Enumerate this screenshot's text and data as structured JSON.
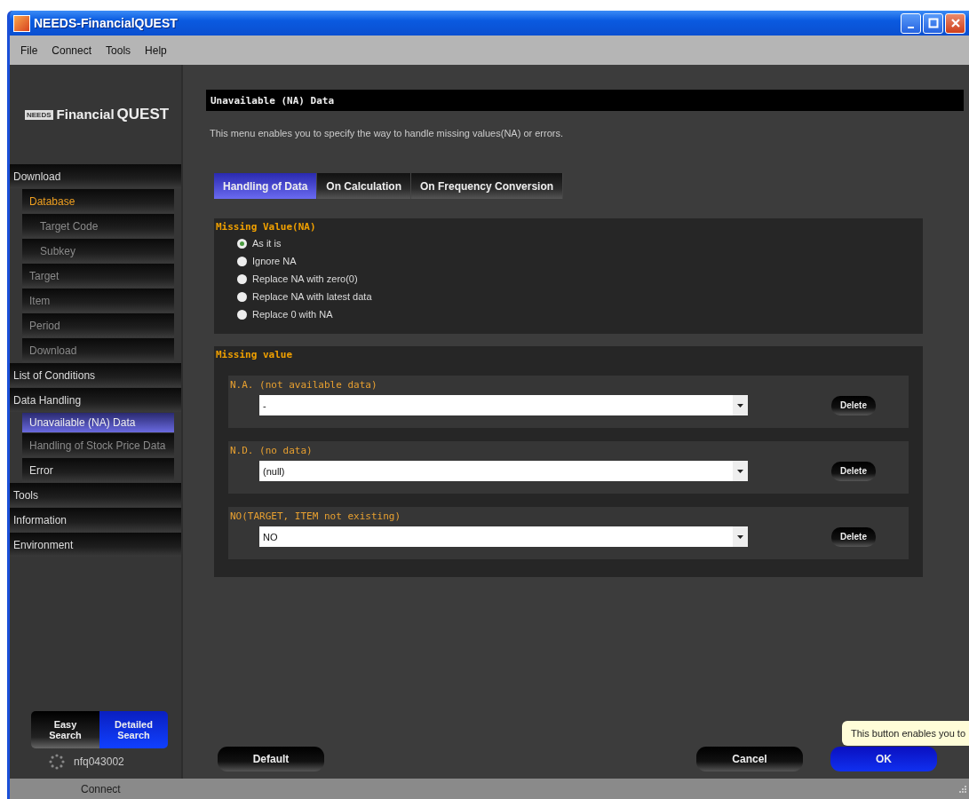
{
  "window": {
    "title": "NEEDS-FinancialQUEST"
  },
  "menu_bar": [
    "File",
    "Connect",
    "Tools",
    "Help"
  ],
  "sidebar": {
    "logo": {
      "badge": "NEEDS",
      "name": "Financial",
      "accent": "QUEST"
    },
    "items": [
      {
        "label": "Download",
        "selected": false,
        "current": false,
        "disabled": false,
        "children": [
          {
            "label": "Database",
            "selected": false,
            "current": true,
            "disabled": false,
            "children": [
              {
                "label": "Target Code",
                "selected": false,
                "current": false,
                "disabled": true
              },
              {
                "label": "Subkey",
                "selected": false,
                "current": false,
                "disabled": true
              }
            ]
          },
          {
            "label": "Target",
            "selected": false,
            "current": false,
            "disabled": true
          },
          {
            "label": "Item",
            "selected": false,
            "current": false,
            "disabled": true
          },
          {
            "label": "Period",
            "selected": false,
            "current": false,
            "disabled": true
          },
          {
            "label": "Download",
            "selected": false,
            "current": false,
            "disabled": true
          }
        ]
      },
      {
        "label": "List of Conditions",
        "selected": false,
        "current": false,
        "disabled": false
      },
      {
        "label": "Data Handling",
        "selected": false,
        "current": false,
        "disabled": false,
        "children": [
          {
            "label": "Unavailable (NA) Data",
            "selected": true,
            "current": false,
            "disabled": false
          },
          {
            "label": "Handling of Stock Price Data",
            "selected": false,
            "current": false,
            "disabled": true
          },
          {
            "label": "Error",
            "selected": false,
            "current": false,
            "disabled": false
          }
        ]
      },
      {
        "label": "Tools",
        "selected": false,
        "current": false,
        "disabled": false
      },
      {
        "label": "Information",
        "selected": false,
        "current": false,
        "disabled": false
      },
      {
        "label": "Environment",
        "selected": false,
        "current": false,
        "disabled": false
      }
    ],
    "search_modes": [
      {
        "label": "Easy Search",
        "selected": false
      },
      {
        "label": "Detailed Search",
        "selected": true
      }
    ],
    "user_id": "nfq043002"
  },
  "page": {
    "title": "Unavailable (NA) Data",
    "description": "This menu enables you to specify the way to handle missing values(NA) or errors.",
    "tabs": [
      {
        "label": "Handling of Data",
        "selected": true
      },
      {
        "label": "On Calculation",
        "selected": false
      },
      {
        "label": "On Frequency Conversion",
        "selected": false
      }
    ],
    "missing_value_na": {
      "title": "Missing Value(NA)",
      "options": [
        {
          "label": "As it is",
          "selected": true
        },
        {
          "label": "Ignore NA",
          "selected": false
        },
        {
          "label": "Replace NA with zero(0)",
          "selected": false
        },
        {
          "label": "Replace NA with latest data",
          "selected": false
        },
        {
          "label": "Replace 0 with NA",
          "selected": false
        }
      ]
    },
    "missing_value": {
      "title": "Missing value",
      "rows": [
        {
          "label": "N.A. (not available data)",
          "value": "-",
          "button": "Delete"
        },
        {
          "label": "N.D. (no data)",
          "value": "(null)",
          "button": "Delete"
        },
        {
          "label": "NO(TARGET, ITEM not existing)",
          "value": "NO",
          "button": "Delete"
        }
      ]
    }
  },
  "buttons": [
    {
      "label": "Default",
      "kind": "plain"
    },
    {
      "label": "Cancel",
      "kind": "plain"
    },
    {
      "label": "OK",
      "kind": "primary"
    }
  ],
  "tooltip": "This button enables you to",
  "status_bar": "Connect"
}
